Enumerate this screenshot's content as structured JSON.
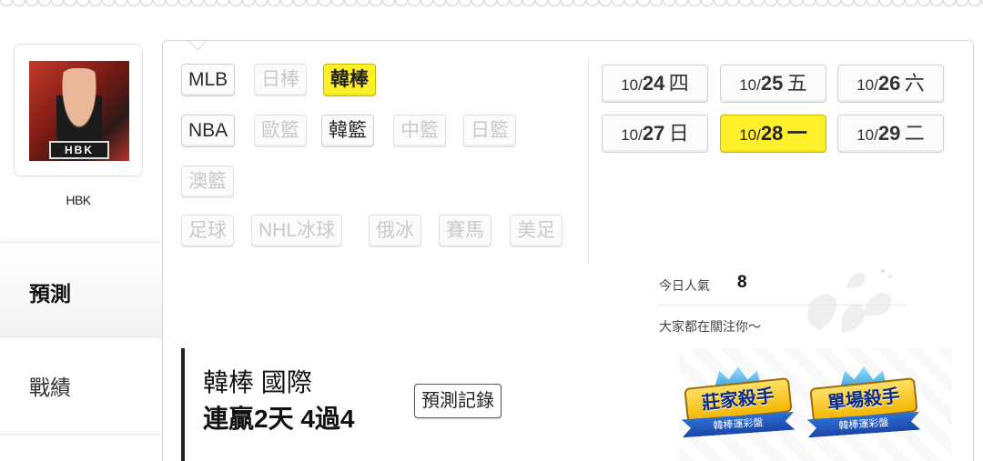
{
  "user": {
    "name": "HBK",
    "avatar_plate": "HBK"
  },
  "side_tabs": [
    {
      "label": "預測",
      "active": true
    },
    {
      "label": "戰績",
      "active": false
    }
  ],
  "leagues": {
    "row1": [
      {
        "label": "MLB",
        "state": "enabled"
      },
      {
        "label": "日棒",
        "state": "disabled"
      },
      {
        "label": "韓棒",
        "state": "selected"
      }
    ],
    "row2": [
      {
        "label": "NBA",
        "state": "enabled"
      },
      {
        "label": "歐籃",
        "state": "disabled"
      },
      {
        "label": "韓籃",
        "state": "enabled"
      },
      {
        "label": "中籃",
        "state": "disabled"
      },
      {
        "label": "日籃",
        "state": "disabled"
      }
    ],
    "row3": [
      {
        "label": "澳籃",
        "state": "disabled"
      }
    ],
    "row4": [
      {
        "label": "足球",
        "state": "disabled"
      },
      {
        "label": "NHL冰球",
        "state": "disabled"
      },
      {
        "label": "俄冰",
        "state": "disabled"
      },
      {
        "label": "賽馬",
        "state": "disabled"
      },
      {
        "label": "美足",
        "state": "disabled"
      }
    ]
  },
  "dates": [
    {
      "month": "10/",
      "day": "24",
      "weekday": "四",
      "selected": false
    },
    {
      "month": "10/",
      "day": "25",
      "weekday": "五",
      "selected": false
    },
    {
      "month": "10/",
      "day": "26",
      "weekday": "六",
      "selected": false
    },
    {
      "month": "10/",
      "day": "27",
      "weekday": "日",
      "selected": false
    },
    {
      "month": "10/",
      "day": "28",
      "weekday": "一",
      "selected": true
    },
    {
      "month": "10/",
      "day": "29",
      "weekday": "二",
      "selected": false
    }
  ],
  "popularity": {
    "label": "今日人氣",
    "value": "8",
    "subtitle": "大家都在關注你～"
  },
  "record": {
    "title": "韓棒 國際",
    "stat": "連贏2天 4過4",
    "button_label": "預測記錄"
  },
  "badges": [
    {
      "title": "莊家殺手",
      "ribbon": "韓棒運彩盤"
    },
    {
      "title": "單場殺手",
      "ribbon": "韓棒運彩盤"
    }
  ],
  "colors": {
    "selected": "#fff02a",
    "disabled_text": "#c9c9c9",
    "badge_text": "#0d2a82"
  }
}
